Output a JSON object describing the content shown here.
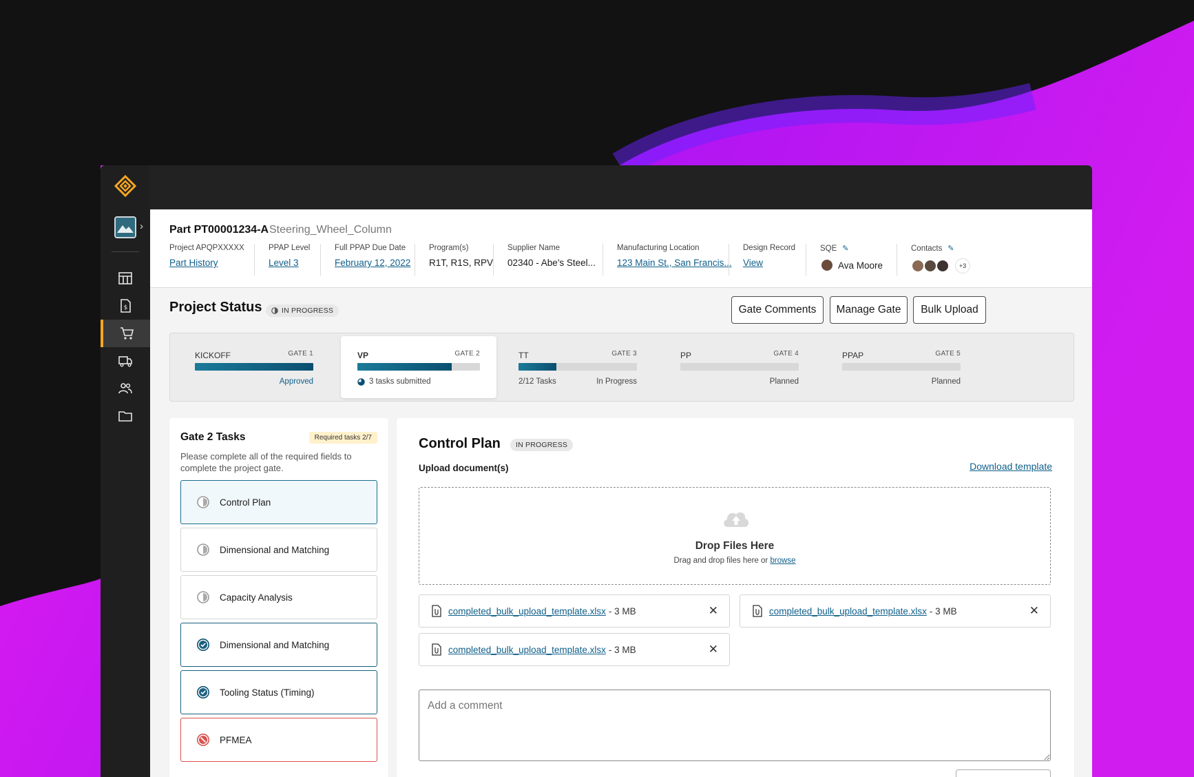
{
  "header": {
    "part_id": "Part PT00001234-A",
    "part_name": "Steering_Wheel_Column",
    "fields": [
      {
        "label": "Project APQPXXXXX",
        "value": "Part History",
        "link": true
      },
      {
        "label": "PPAP Level",
        "value": "Level 3",
        "link": true
      },
      {
        "label": "Full PPAP Due Date",
        "value": "February 12, 2022",
        "link": true
      },
      {
        "label": "Program(s)",
        "value": "R1T, R1S, RPV",
        "link": false
      },
      {
        "label": "Supplier Name",
        "value": "02340 - Abe's Steel...",
        "link": false
      },
      {
        "label": "Manufacturing Location",
        "value": "123 Main St., San Francis...",
        "link": true
      },
      {
        "label": "Design Record",
        "value": "View",
        "link": true
      },
      {
        "label": "SQE",
        "value": "Ava Moore",
        "link": false
      },
      {
        "label": "Contacts",
        "value": "+3",
        "link": false
      }
    ]
  },
  "project_status": {
    "title": "Project Status",
    "status": "IN PROGRESS",
    "buttons": {
      "gate_comments": "Gate Comments",
      "manage_gate": "Manage Gate",
      "bulk_upload": "Bulk Upload"
    }
  },
  "gates": [
    {
      "name": "KICKOFF",
      "gate": "GATE 1",
      "progress": 1.0,
      "left_text": "",
      "right_text": "Approved",
      "active": false
    },
    {
      "name": "VP",
      "gate": "GATE 2",
      "progress": 0.77,
      "left_text": "3 tasks submitted",
      "right_text": "",
      "active": true
    },
    {
      "name": "TT",
      "gate": "GATE 3",
      "progress": 0.32,
      "left_text": "2/12 Tasks",
      "right_text": "In Progress",
      "active": false
    },
    {
      "name": "PP",
      "gate": "GATE 4",
      "progress": 0,
      "left_text": "",
      "right_text": "Planned",
      "active": false
    },
    {
      "name": "PPAP",
      "gate": "GATE 5",
      "progress": 0,
      "left_text": "",
      "right_text": "Planned",
      "active": false
    }
  ],
  "tasks_panel": {
    "title": "Gate 2 Tasks",
    "required_badge": "Required tasks 2/7",
    "description": "Please complete all of the required fields to complete the project gate.",
    "tasks": [
      {
        "label": "Control Plan",
        "state": "in-progress"
      },
      {
        "label": "Dimensional and Matching",
        "state": "in-progress"
      },
      {
        "label": "Capacity Analysis",
        "state": "in-progress"
      },
      {
        "label": "Dimensional and Matching",
        "state": "done"
      },
      {
        "label": "Tooling Status (Timing)",
        "state": "done"
      },
      {
        "label": "PFMEA",
        "state": "error"
      }
    ]
  },
  "control_plan": {
    "title": "Control Plan",
    "status": "IN PROGRESS",
    "upload_label": "Upload document(s)",
    "download_template": "Download template",
    "drop_title": "Drop Files Here",
    "drop_sub": "Drag and drop files here or",
    "drop_browse": "browse",
    "files": [
      {
        "name": "completed_bulk_upload_template.xlsx",
        "size": "- 3 MB"
      },
      {
        "name": "completed_bulk_upload_template.xlsx",
        "size": "- 3 MB"
      },
      {
        "name": "completed_bulk_upload_template.xlsx",
        "size": "- 3 MB"
      }
    ],
    "comment_placeholder": "Add a comment"
  },
  "colors": {
    "accent": "#f5a623",
    "link": "#0f5f8a",
    "progress": "#0b4f70",
    "error": "#d9534f"
  }
}
